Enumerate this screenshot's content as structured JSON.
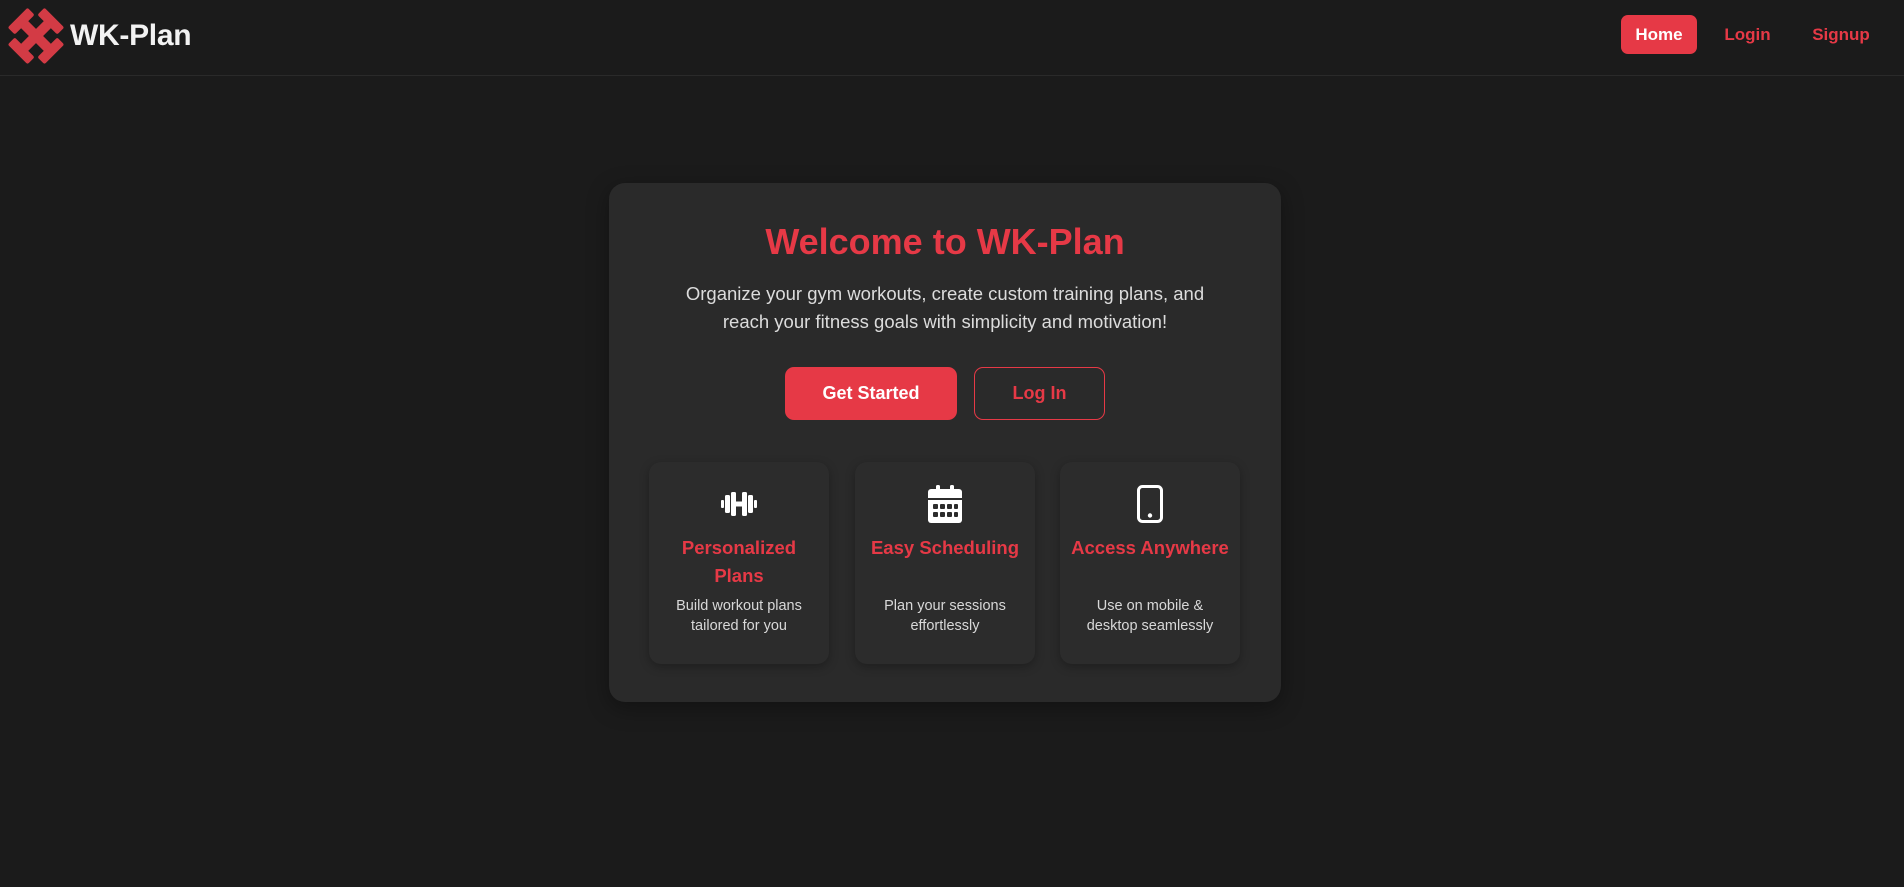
{
  "brand": {
    "name": "WK-Plan",
    "logo_icon": "crossed-dumbbells-icon"
  },
  "nav": {
    "items": [
      {
        "label": "Home",
        "active": true
      },
      {
        "label": "Login",
        "active": false
      },
      {
        "label": "Signup",
        "active": false
      }
    ]
  },
  "hero": {
    "title": "Welcome to WK-Plan",
    "subtitle": "Organize your gym workouts, create custom training plans, and reach your fitness goals with simplicity and motivation!",
    "primary_button": "Get Started",
    "secondary_button": "Log In"
  },
  "features": [
    {
      "icon": "dumbbell-icon",
      "title": "Personalized Plans",
      "description": "Build workout plans tailored for you"
    },
    {
      "icon": "calendar-icon",
      "title": "Easy Scheduling",
      "description": "Plan your sessions effortlessly"
    },
    {
      "icon": "mobile-icon",
      "title": "Access Anywhere",
      "description": "Use on mobile & desktop seamlessly"
    }
  ],
  "colors": {
    "accent": "#e63946",
    "background": "#1b1b1b",
    "card": "#2a2a2a",
    "text": "#e6e6e6"
  }
}
